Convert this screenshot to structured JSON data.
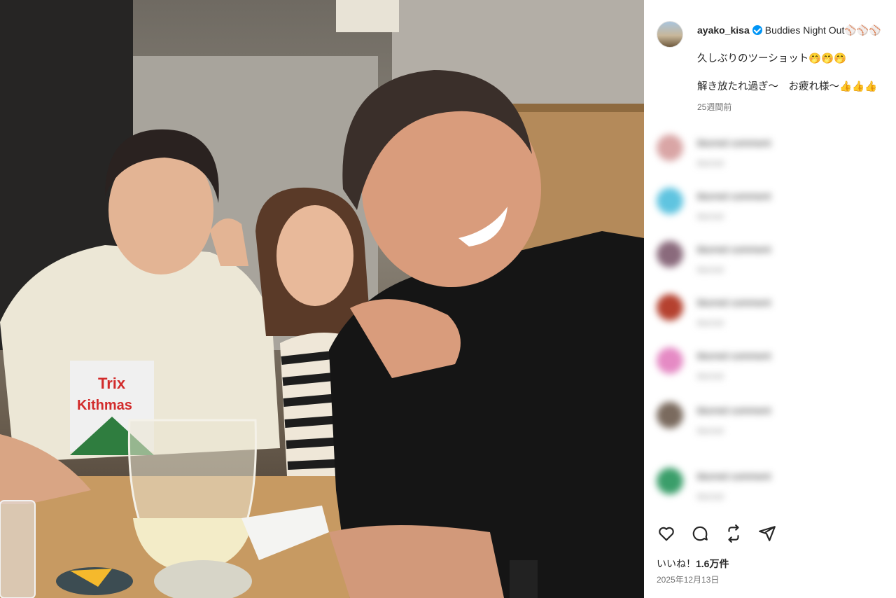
{
  "post": {
    "username": "ayako_kisa",
    "caption_title": "Buddies Night Out⚾⚾⚾",
    "caption_lines": [
      "久しぶりのツーショット🤭🤭🤭",
      "解き放たれ過ぎ〜　お疲れ様〜👍👍👍"
    ],
    "posted_ago": "25週間前",
    "likes_label": "いいね！",
    "likes_count": "1.6万件",
    "date": "2025年12月13日"
  },
  "photo": {
    "shirt_text": [
      "Trix",
      "Kithmas"
    ]
  },
  "comments": [
    {
      "text": "blurred comment",
      "meta": "blurred",
      "avatar_color": "#d9a5a5"
    },
    {
      "text": "blurred comment",
      "meta": "blurred",
      "avatar_color": "#5fc4e0"
    },
    {
      "text": "blurred comment",
      "meta": "blurred",
      "avatar_color": "#8a6a7c"
    },
    {
      "text": "blurred comment",
      "meta": "blurred",
      "avatar_color": "#b5412f"
    },
    {
      "text": "blurred comment",
      "meta": "blurred",
      "avatar_color": "#e58ac4"
    },
    {
      "text": "blurred comment",
      "meta": "blurred",
      "avatar_color": "#7a6a5e"
    },
    {
      "text": "blurred comment",
      "meta": "blurred",
      "avatar_color": "#3a9e6a"
    }
  ],
  "icons": [
    "heart-icon",
    "comment-icon",
    "repost-icon",
    "share-icon"
  ],
  "colors": {
    "verified": "#0095f6",
    "muted": "#737373"
  }
}
